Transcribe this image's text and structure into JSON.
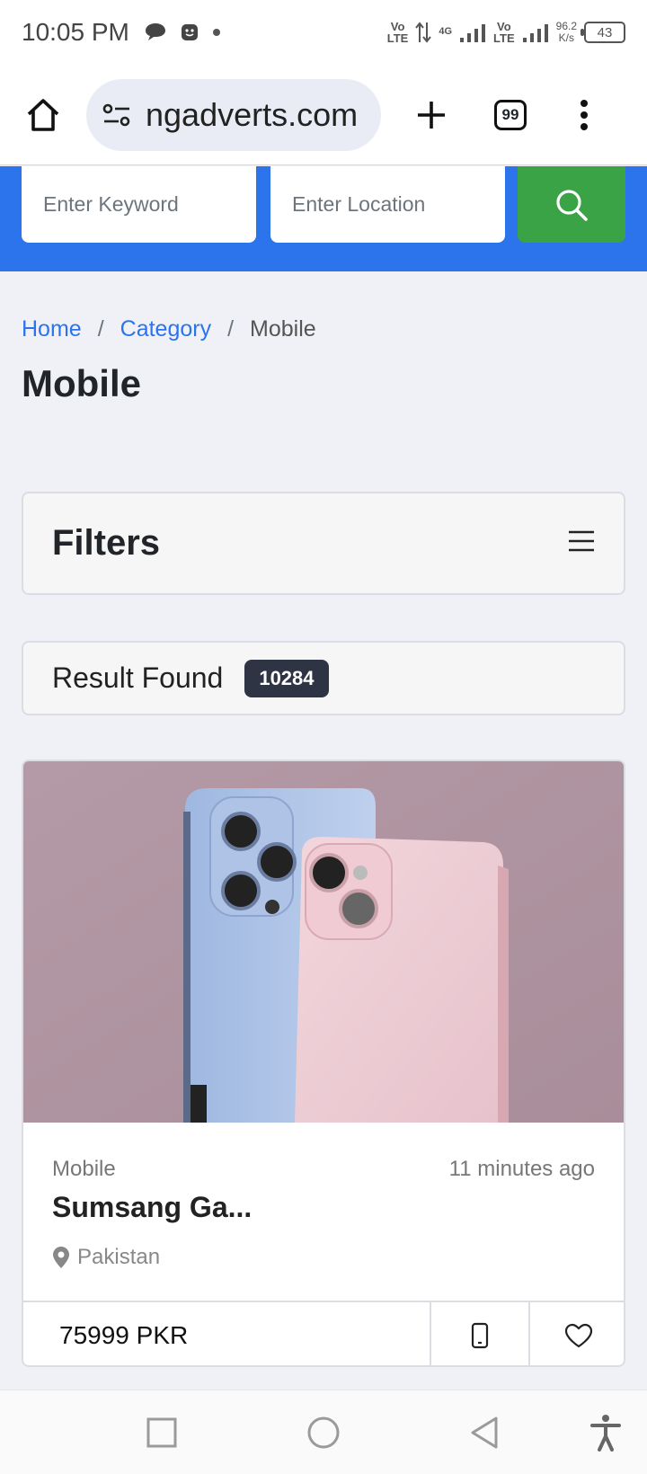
{
  "status_bar": {
    "time": "10:05 PM",
    "net1": [
      "Vo",
      "LTE"
    ],
    "net_gen": "4G",
    "net2": [
      "Vo",
      "LTE"
    ],
    "speed": [
      "96.2",
      "K/s"
    ],
    "battery": "43"
  },
  "browser": {
    "url": "ngadverts.com",
    "tab_count": "99"
  },
  "search": {
    "keyword_placeholder": "Enter Keyword",
    "location_placeholder": "Enter Location"
  },
  "breadcrumb": {
    "home": "Home",
    "separator": "/",
    "category": "Category",
    "current": "Mobile"
  },
  "page": {
    "title": "Mobile"
  },
  "filters": {
    "title": "Filters"
  },
  "results": {
    "label": "Result Found",
    "count": "10284"
  },
  "listing": {
    "category": "Mobile",
    "posted": "11 minutes ago",
    "title": "Sumsang Ga...",
    "location": "Pakistan",
    "price": "75999 PKR"
  },
  "colors": {
    "primary": "#2b74ec",
    "search_button": "#3aa346",
    "badge": "#2f3445",
    "background": "#f0f1f6"
  }
}
